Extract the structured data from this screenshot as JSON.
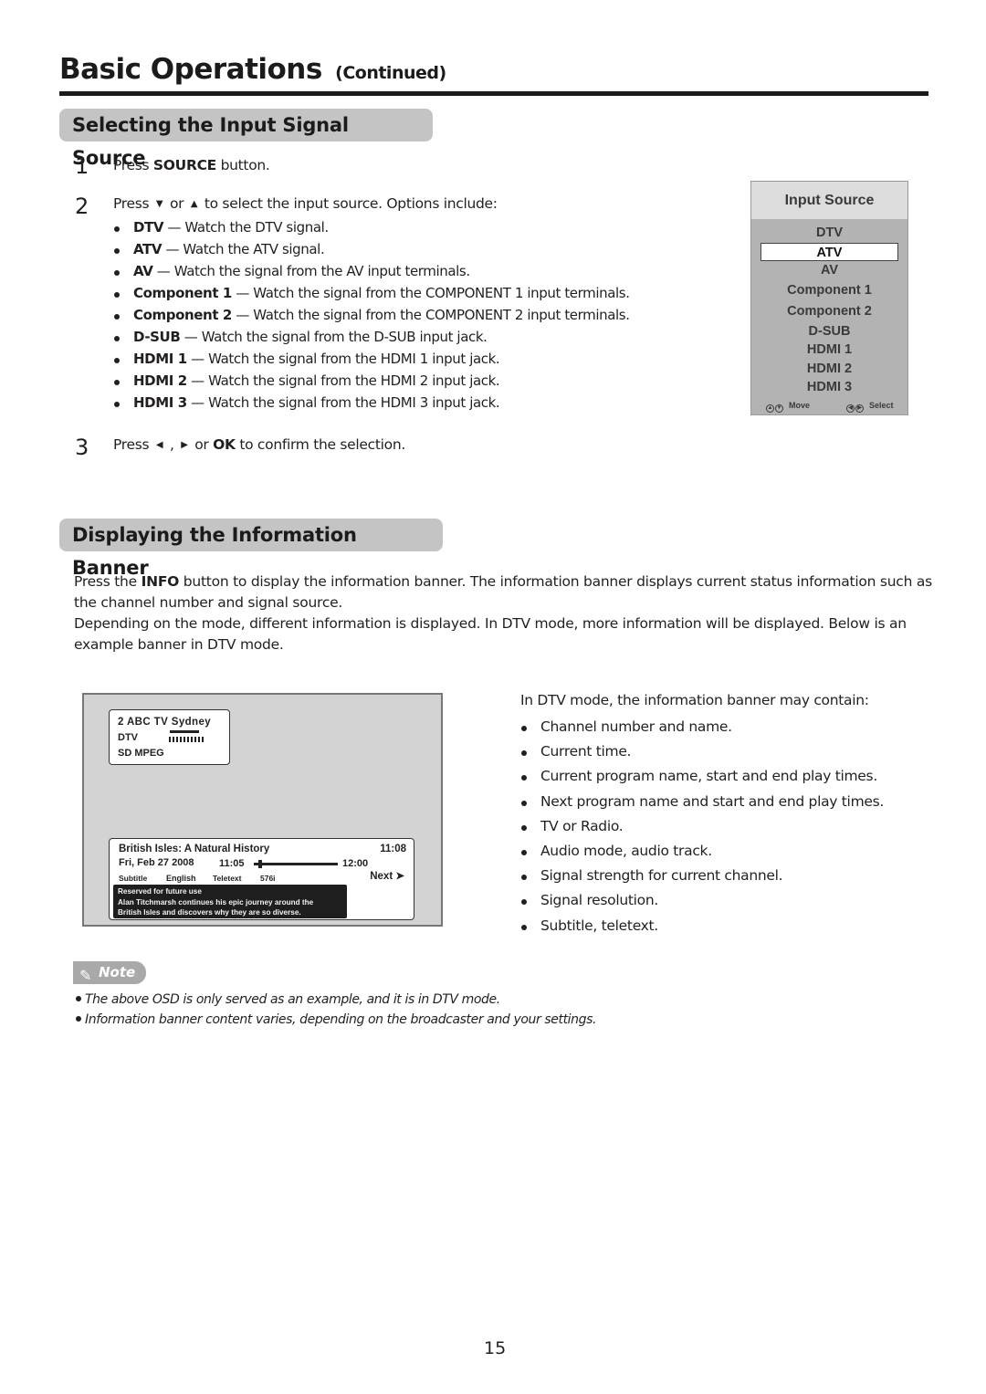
{
  "header": {
    "title": "Basic Operations",
    "title_suffix": "(Continued)"
  },
  "section_input": {
    "heading": "Selecting the Input Signal Source",
    "steps": [
      {
        "num": "1",
        "pre": "Press ",
        "bold": "SOURCE",
        "post": " button."
      },
      {
        "num": "2",
        "pre": "Press ",
        "arrow_down": "▼",
        "mid": " or ",
        "arrow_up": "▲",
        "post": " to select the input source. Options include:"
      },
      {
        "num": "3",
        "pre": "Press ",
        "arrow_left": "◀",
        "sep": " , ",
        "arrow_right": "▶",
        "mid": " or ",
        "bold": "OK",
        "post": " to confirm the selection."
      }
    ],
    "options": [
      {
        "name": "DTV",
        "desc": " — Watch the DTV signal."
      },
      {
        "name": "ATV",
        "desc": " — Watch the ATV signal."
      },
      {
        "name": "AV",
        "desc": " — Watch the signal from the AV input terminals."
      },
      {
        "name": "Component 1",
        "desc": " — Watch the signal from the COMPONENT 1 input terminals."
      },
      {
        "name": "Component 2",
        "desc": " — Watch the signal from the COMPONENT 2 input terminals."
      },
      {
        "name": "D-SUB",
        "desc": " — Watch the signal from the D-SUB input jack."
      },
      {
        "name": "HDMI 1",
        "desc": " — Watch the signal from the HDMI 1 input jack."
      },
      {
        "name": "HDMI 2",
        "desc": " — Watch the signal from the HDMI 2 input jack."
      },
      {
        "name": "HDMI 3",
        "desc": " — Watch the signal from the HDMI 3 input jack."
      }
    ],
    "osd": {
      "title": "Input Source",
      "items": [
        "DTV",
        "ATV",
        "AV",
        "Component 1",
        "Component 2",
        "D-SUB",
        "HDMI 1",
        "HDMI 2",
        "HDMI 3"
      ],
      "selected": "ATV",
      "footer_move": "Move",
      "footer_select": "Select",
      "icons": {
        "up": "▲",
        "down": "▼",
        "left": "◀",
        "right": "▶"
      }
    }
  },
  "section_banner": {
    "heading": "Displaying the Information Banner",
    "para1_pre": "Press the ",
    "para1_bold": "INFO",
    "para1_post": " button to display the information banner. The information banner displays current status information such as the channel number and signal source.",
    "para2": "Depending on the mode, different information is displayed. In DTV mode, more information will be displayed. Below is an example banner in DTV mode.",
    "example": {
      "channel": "2  ABC TV Sydney",
      "mode": "DTV",
      "format": "SD  MPEG",
      "program_title": "British Isles: A Natural History",
      "current_time": "11:08",
      "date": "Fri, Feb 27 2008",
      "start_time": "11:05",
      "end_time": "12:00",
      "progress_fraction": 0.05,
      "next_label": "Next ➤",
      "tags": [
        "Subtitle",
        "English",
        "Teletext",
        "576i"
      ],
      "desc_lines": [
        "Reserved for future use",
        "Alan Titchmarsh continues his epic journey around the",
        "British Isles and discovers why they are so diverse."
      ]
    },
    "info_intro": "In DTV mode, the information banner may contain:",
    "info_items": [
      "Channel number and name.",
      "Current time.",
      "Current program name, start and end play times.",
      "Next program name and start and end play times.",
      "TV or Radio.",
      "Audio mode, audio track.",
      "Signal strength for current channel.",
      "Signal resolution.",
      "Subtitle, teletext."
    ]
  },
  "note": {
    "label": "Note",
    "lines": [
      "The above OSD is only served as an example, and it is in DTV mode.",
      "Information banner content varies, depending on the broadcaster and your settings."
    ]
  },
  "page_number": "15"
}
